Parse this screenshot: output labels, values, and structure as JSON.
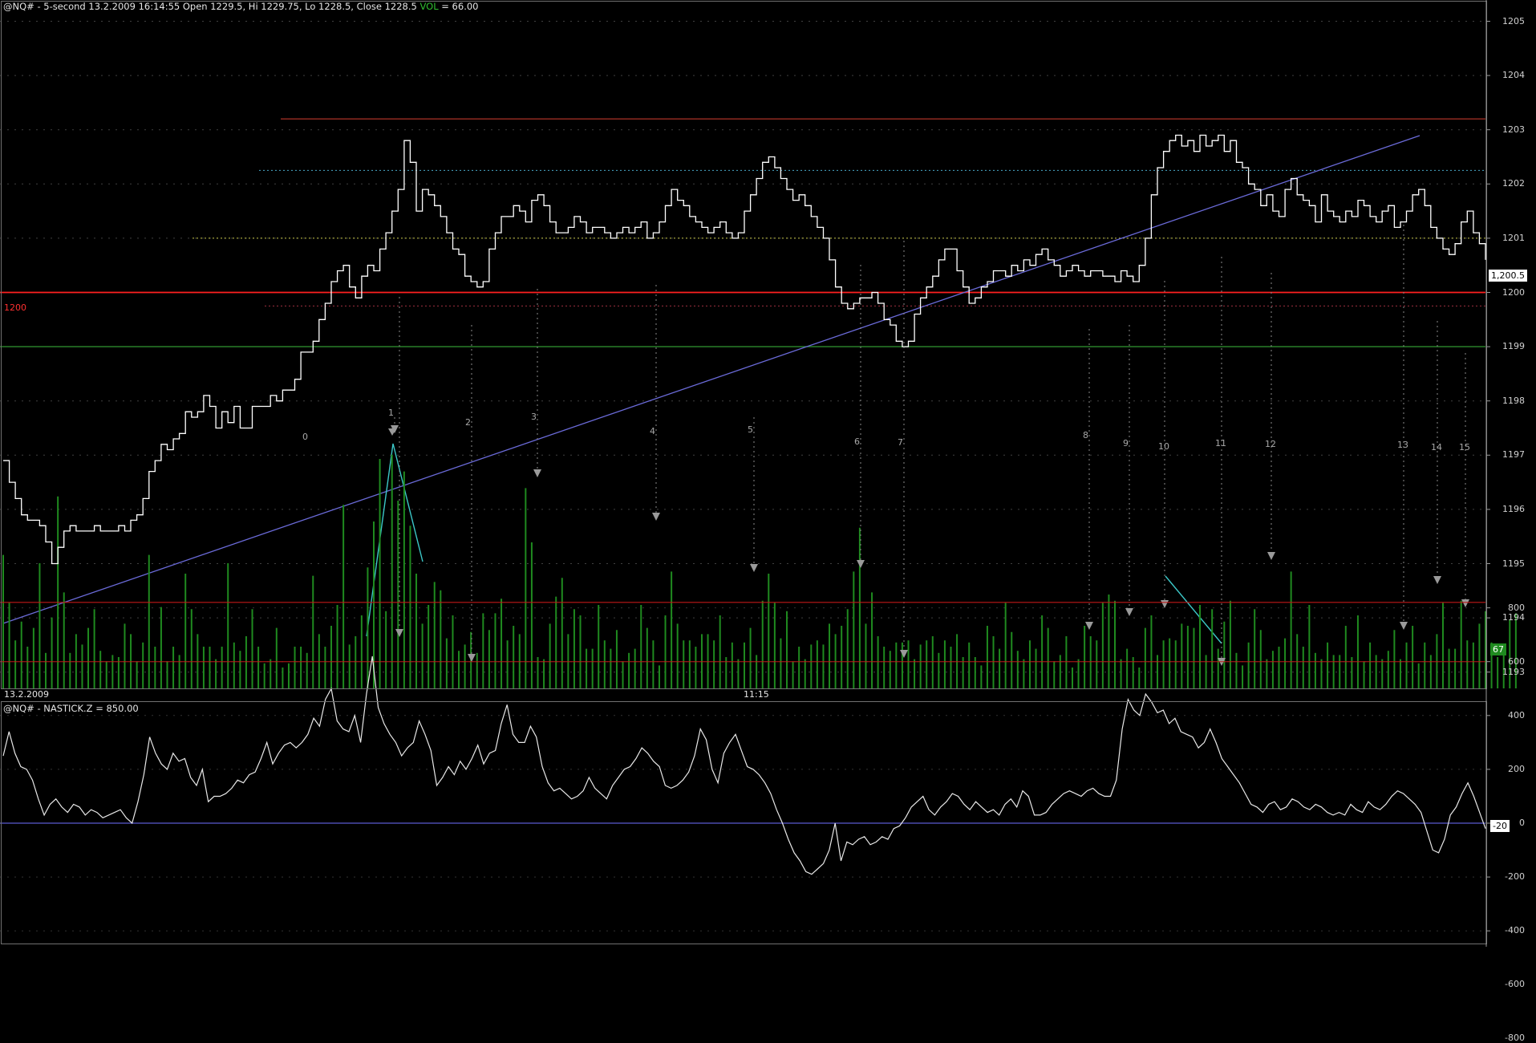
{
  "price_panel": {
    "header": {
      "prefix": "@NQ# - 5-second 13.2.2009 16:14:55 Open 1229.5, Hi 1229.75, Lo 1228.5, Close 1228.5",
      "vol_label": "VOL",
      "vol_value": " = 66.00"
    },
    "red_level_label": "1200",
    "last_price_label": "1,200.5",
    "volume_label": "67",
    "date_label": "13.2.2009",
    "time_label": "11:15",
    "y_ticks": [
      "1205",
      "1204",
      "1203",
      "1202",
      "1201",
      "1200",
      "1199",
      "1198",
      "1197",
      "1196",
      "1195",
      "1194",
      "1193"
    ]
  },
  "indicator_panel": {
    "header": "@NQ# - NASTICK.Z = 850.00",
    "last_value_label": "-20",
    "y_ticks": [
      "800",
      "600",
      "400",
      "200",
      "0",
      "-200",
      "-400",
      "-600",
      "-800"
    ]
  },
  "annotations": [
    "0",
    "1",
    "2",
    "3",
    "4",
    "5",
    "6",
    "7",
    "8",
    "9",
    "10",
    "11",
    "12",
    "13",
    "14",
    "15"
  ],
  "colors": {
    "background": "#000000",
    "price_line": "#ffffff",
    "volume": "#1f8a1f",
    "resistance": "#c0392b",
    "level_1200": "#ff2020",
    "level_1199": "#2e8b2e",
    "trend": "#6a6ad8",
    "cyan_lines": "#3cc8c8",
    "dotted_1202": "#4aa8c8",
    "dotted_1201": "#c8c84a",
    "indicator_line": "#e8e8e8",
    "indicator_zero": "#5a5ad0",
    "indicator_upper": "#c01818",
    "indicator_lower": "#1a9a1a"
  },
  "chart_data": [
    {
      "type": "line",
      "ylim": [
        1193,
        1205.5
      ],
      "x": [
        0,
        1,
        2,
        3,
        4,
        5,
        6,
        7,
        8,
        9,
        10,
        11,
        12,
        13,
        14,
        15,
        16,
        17,
        18,
        19,
        20,
        21,
        22,
        23,
        24,
        25,
        26,
        27,
        28,
        29,
        30,
        31,
        32,
        33,
        34,
        35,
        36,
        37,
        38,
        39,
        40,
        41,
        42,
        43,
        44,
        45,
        46,
        47,
        48,
        49,
        50,
        51,
        52,
        53,
        54,
        55,
        56,
        57,
        58,
        59,
        60,
        61,
        62,
        63,
        64,
        65,
        66,
        67,
        68,
        69,
        70,
        71,
        72,
        73,
        74,
        75,
        76,
        77,
        78,
        79,
        80,
        81,
        82,
        83,
        84,
        85,
        86,
        87,
        88,
        89,
        90,
        91,
        92,
        93,
        94,
        95,
        96,
        97,
        98,
        99,
        100,
        101,
        102,
        103,
        104,
        105,
        106,
        107,
        108,
        109,
        110,
        111,
        112,
        113,
        114,
        115,
        116,
        117,
        118,
        119,
        120,
        121,
        122,
        123,
        124,
        125,
        126,
        127,
        128,
        129,
        130,
        131,
        132,
        133,
        134,
        135,
        136,
        137,
        138,
        139,
        140,
        141,
        142,
        143,
        144,
        145,
        146,
        147,
        148,
        149,
        150,
        151,
        152,
        153,
        154,
        155,
        156,
        157,
        158,
        159,
        160,
        161,
        162,
        163,
        164,
        165,
        166,
        167,
        168,
        169,
        170,
        171,
        172,
        173,
        174,
        175,
        176,
        177,
        178,
        179,
        180,
        181,
        182,
        183,
        184,
        185,
        186,
        187,
        188,
        189,
        190,
        191,
        192,
        193,
        194,
        195,
        196,
        197,
        198,
        199,
        200,
        201,
        202,
        203,
        204,
        205,
        206,
        207,
        208,
        209,
        210,
        211,
        212,
        213,
        214,
        215,
        216,
        217,
        218,
        219,
        220,
        221,
        222,
        223,
        224,
        225,
        226,
        227,
        228,
        229,
        230,
        231,
        232,
        233,
        234,
        235,
        236,
        237,
        238,
        239,
        240,
        241,
        242,
        243,
        244,
        245,
        246,
        247,
        248,
        249
      ],
      "series": [
        {
          "values": [
            1196.9,
            1196.5,
            1196.2,
            1195.9,
            1195.8,
            1195.8,
            1195.7,
            1195.4,
            1195.0,
            1195.3,
            1195.6,
            1195.7,
            1195.6,
            1195.6,
            1195.6,
            1195.7,
            1195.6,
            1195.6,
            1195.6,
            1195.7,
            1195.6,
            1195.8,
            1195.9,
            1196.2,
            1196.7,
            1196.9,
            1197.2,
            1197.1,
            1197.3,
            1197.4,
            1197.8,
            1197.7,
            1197.8,
            1198.1,
            1197.9,
            1197.5,
            1197.8,
            1197.6,
            1197.9,
            1197.5,
            1197.5,
            1197.9,
            1197.9,
            1197.9,
            1198.1,
            1198.0,
            1198.2,
            1198.2,
            1198.4,
            1198.9,
            1198.9,
            1199.1,
            1199.5,
            1199.8,
            1200.2,
            1200.4,
            1200.5,
            1200.1,
            1199.9,
            1200.3,
            1200.5,
            1200.4,
            1200.8,
            1201.1,
            1201.5,
            1201.9,
            1202.8,
            1202.4,
            1201.5,
            1201.9,
            1201.8,
            1201.6,
            1201.4,
            1201.1,
            1200.8,
            1200.7,
            1200.3,
            1200.2,
            1200.1,
            1200.2,
            1200.8,
            1201.1,
            1201.4,
            1201.4,
            1201.6,
            1201.5,
            1201.3,
            1201.7,
            1201.8,
            1201.6,
            1201.3,
            1201.1,
            1201.1,
            1201.2,
            1201.4,
            1201.3,
            1201.1,
            1201.2,
            1201.2,
            1201.1,
            1201.0,
            1201.1,
            1201.2,
            1201.1,
            1201.2,
            1201.3,
            1201.0,
            1201.1,
            1201.3,
            1201.6,
            1201.9,
            1201.7,
            1201.6,
            1201.4,
            1201.3,
            1201.2,
            1201.1,
            1201.2,
            1201.3,
            1201.1,
            1201.0,
            1201.1,
            1201.5,
            1201.8,
            1202.1,
            1202.4,
            1202.5,
            1202.3,
            1202.1,
            1201.9,
            1201.7,
            1201.8,
            1201.6,
            1201.4,
            1201.2,
            1201.0,
            1200.6,
            1200.1,
            1199.8,
            1199.7,
            1199.8,
            1199.9,
            1199.9,
            1200.0,
            1199.8,
            1199.5,
            1199.4,
            1199.1,
            1199.0,
            1199.1,
            1199.6,
            1199.9,
            1200.1,
            1200.3,
            1200.6,
            1200.8,
            1200.8,
            1200.4,
            1200.1,
            1199.8,
            1199.9,
            1200.1,
            1200.2,
            1200.4,
            1200.4,
            1200.3,
            1200.5,
            1200.4,
            1200.6,
            1200.5,
            1200.7,
            1200.8,
            1200.6,
            1200.5,
            1200.3,
            1200.4,
            1200.5,
            1200.4,
            1200.3,
            1200.4,
            1200.4,
            1200.3,
            1200.3,
            1200.2,
            1200.4,
            1200.3,
            1200.2,
            1200.5,
            1201.0,
            1201.8,
            1202.3,
            1202.6,
            1202.8,
            1202.9,
            1202.7,
            1202.8,
            1202.6,
            1202.9,
            1202.7,
            1202.8,
            1202.9,
            1202.6,
            1202.8,
            1202.4,
            1202.3,
            1202.0,
            1201.9,
            1201.6,
            1201.8,
            1201.5,
            1201.4,
            1201.9,
            1202.1,
            1201.8,
            1201.7,
            1201.6,
            1201.3,
            1201.8,
            1201.5,
            1201.4,
            1201.3,
            1201.5,
            1201.4,
            1201.7,
            1201.6,
            1201.4,
            1201.3,
            1201.5,
            1201.6,
            1201.2,
            1201.3,
            1201.5,
            1201.8,
            1201.9,
            1201.6,
            1201.2,
            1201.0,
            1200.8,
            1200.7,
            1200.9,
            1201.3,
            1201.5,
            1201.1,
            1200.9,
            1200.6
          ]
        }
      ]
    },
    {
      "type": "bar",
      "series": [
        {
          "values": [
            64,
            41,
            23,
            32,
            20,
            29,
            60,
            17,
            34,
            92,
            46,
            17,
            26,
            21,
            29,
            38,
            18,
            13,
            16,
            15,
            31,
            26,
            13,
            22,
            64,
            20,
            39,
            13,
            20,
            16,
            55,
            38,
            26,
            20,
            20,
            14,
            20,
            60,
            22,
            18,
            25,
            38,
            20,
            12,
            14,
            29,
            10,
            12,
            20,
            20,
            17,
            54,
            26,
            20,
            30,
            40,
            88,
            21,
            25,
            35,
            58,
            80,
            110,
            37,
            112,
            90,
            104,
            78,
            55,
            31,
            40,
            51,
            47,
            24,
            35,
            18,
            21,
            27,
            17,
            36,
            28,
            36,
            43,
            23,
            30,
            26,
            96,
            70,
            15,
            14,
            31,
            44,
            53,
            26,
            38,
            35,
            19,
            19,
            40,
            23,
            19,
            28,
            13,
            17,
            19,
            40,
            29,
            23,
            11,
            35,
            56,
            31,
            23,
            23,
            20,
            26,
            26,
            23,
            35,
            15,
            22,
            14,
            22,
            29,
            16,
            42,
            55,
            41,
            24,
            37,
            13,
            20,
            14,
            21,
            23,
            21,
            31,
            26,
            30,
            38,
            56,
            77,
            31,
            46,
            25,
            20,
            18,
            22,
            22,
            23,
            14,
            21,
            23,
            25,
            17,
            23,
            20,
            26,
            15,
            22,
            15,
            11,
            30,
            25,
            19,
            41,
            27,
            18,
            14,
            23,
            19,
            35,
            29,
            13,
            16,
            25,
            10,
            14,
            30,
            25,
            23,
            41,
            45,
            42,
            14,
            19,
            15,
            10,
            29,
            35,
            16,
            23,
            24,
            23,
            31,
            30,
            29,
            40,
            16,
            38,
            19,
            32,
            42,
            17,
            11,
            22,
            38,
            28,
            14,
            18,
            20,
            24,
            56,
            26,
            20,
            40,
            17,
            14,
            22,
            16,
            16,
            30,
            15,
            35,
            13,
            22,
            16,
            14,
            18,
            28,
            14,
            22,
            30,
            12,
            22,
            16,
            26,
            41,
            19,
            19,
            42,
            23,
            22,
            31,
            37,
            22,
            15,
            17,
            33,
            36
          ]
        }
      ]
    },
    {
      "type": "line",
      "ylim": [
        -850,
        850
      ],
      "series": [
        {
          "values": [
            250,
            340,
            260,
            210,
            200,
            160,
            90,
            30,
            70,
            90,
            60,
            40,
            70,
            60,
            30,
            50,
            40,
            20,
            30,
            40,
            50,
            20,
            0,
            80,
            180,
            320,
            260,
            220,
            200,
            260,
            230,
            240,
            170,
            140,
            200,
            80,
            100,
            100,
            110,
            130,
            160,
            150,
            180,
            190,
            240,
            300,
            220,
            260,
            290,
            300,
            280,
            300,
            330,
            390,
            360,
            460,
            500,
            380,
            350,
            340,
            400,
            300,
            480,
            620,
            430,
            370,
            330,
            300,
            250,
            280,
            300,
            380,
            330,
            270,
            140,
            170,
            210,
            180,
            230,
            200,
            240,
            290,
            220,
            260,
            270,
            370,
            440,
            330,
            300,
            300,
            360,
            320,
            210,
            150,
            120,
            130,
            110,
            90,
            100,
            120,
            170,
            130,
            110,
            90,
            140,
            170,
            200,
            210,
            240,
            280,
            260,
            230,
            210,
            140,
            130,
            140,
            160,
            190,
            250,
            350,
            310,
            200,
            150,
            260,
            300,
            330,
            270,
            210,
            200,
            180,
            150,
            110,
            50,
            0,
            -60,
            -110,
            -140,
            -180,
            -190,
            -170,
            -150,
            -100,
            0,
            -140,
            -70,
            -80,
            -60,
            -50,
            -80,
            -70,
            -50,
            -60,
            -20,
            -10,
            20,
            60,
            80,
            100,
            50,
            30,
            60,
            80,
            110,
            100,
            70,
            50,
            80,
            60,
            40,
            50,
            30,
            70,
            90,
            60,
            120,
            100,
            30,
            30,
            40,
            70,
            90,
            110,
            120,
            110,
            100,
            120,
            130,
            110,
            100,
            100,
            160,
            350,
            460,
            420,
            400,
            480,
            450,
            410,
            420,
            370,
            390,
            340,
            330,
            320,
            280,
            300,
            350,
            300,
            240,
            210,
            180,
            150,
            110,
            70,
            60,
            40,
            70,
            80,
            50,
            60,
            90,
            80,
            60,
            50,
            70,
            60,
            40,
            30,
            40,
            30,
            70,
            50,
            40,
            80,
            60,
            50,
            70,
            100,
            120,
            110,
            90,
            70,
            40,
            -30,
            -100,
            -110,
            -60,
            30,
            60,
            110,
            150,
            100,
            40,
            -20
          ]
        }
      ]
    }
  ]
}
